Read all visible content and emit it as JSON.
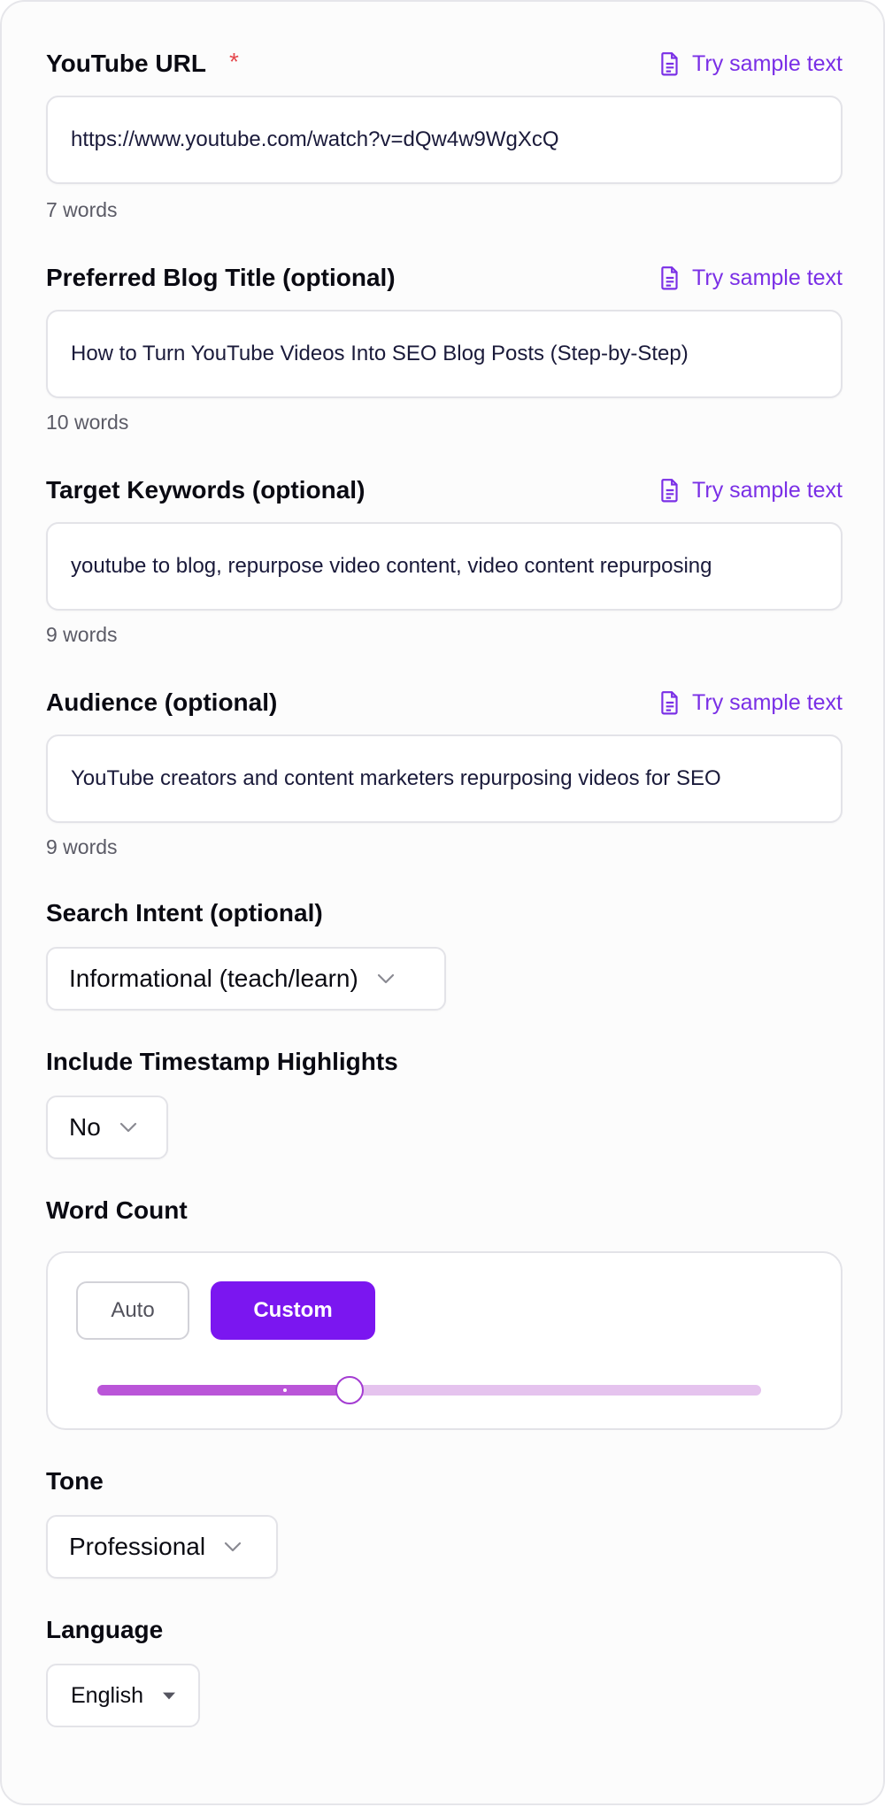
{
  "fields": [
    {
      "label": "YouTube URL",
      "required_marker": "*",
      "value": "https://www.youtube.com/watch?v=dQw4w9WgXcQ",
      "word_count": "7 words",
      "sample_label": "Try sample text"
    },
    {
      "label": "Preferred Blog Title (optional)",
      "value": "How to Turn YouTube Videos Into SEO Blog Posts (Step-by-Step)",
      "word_count": "10 words",
      "sample_label": "Try sample text"
    },
    {
      "label": "Target Keywords (optional)",
      "value": "youtube to blog, repurpose video content, video content repurposing",
      "word_count": "9 words",
      "sample_label": "Try sample text"
    },
    {
      "label": "Audience (optional)",
      "value": "YouTube creators and content marketers repurposing videos for SEO",
      "word_count": "9 words",
      "sample_label": "Try sample text"
    }
  ],
  "search_intent": {
    "label": "Search Intent (optional)",
    "value": "Informational (teach/learn)"
  },
  "timestamp_highlights": {
    "label": "Include Timestamp Highlights",
    "value": "No"
  },
  "word_count": {
    "label": "Word Count",
    "auto_label": "Auto",
    "custom_label": "Custom",
    "selected_mode": "Custom",
    "slider_fraction": 0.38,
    "marker_fraction": 0.28
  },
  "tone": {
    "label": "Tone",
    "value": "Professional"
  },
  "language": {
    "label": "Language",
    "value": "English"
  },
  "colors": {
    "accent": "#7b16f0",
    "link": "#7a2fe6",
    "required": "#e5484d",
    "slider_fill": "#ba55d8",
    "slider_track": "#e5c3ee"
  },
  "icons": {
    "sample": "document-icon",
    "select": "chevron-down-icon",
    "language": "caret-down-icon"
  }
}
